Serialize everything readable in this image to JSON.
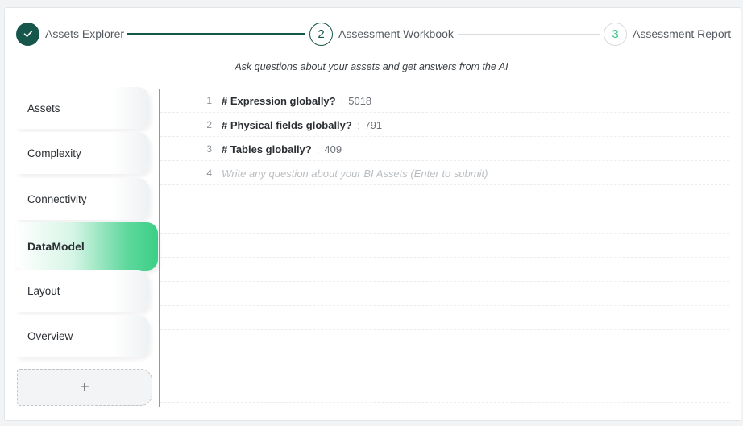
{
  "stepper": {
    "steps": [
      {
        "number": "✓",
        "label": "Assets Explorer",
        "state": "completed"
      },
      {
        "number": "2",
        "label": "Assessment Workbook",
        "state": "active"
      },
      {
        "number": "3",
        "label": "Assessment Report",
        "state": "pending"
      }
    ]
  },
  "subtitle": "Ask questions about your assets and get answers from the AI",
  "sidebar": {
    "items": [
      {
        "label": "Assets"
      },
      {
        "label": "Complexity"
      },
      {
        "label": "Connectivity"
      },
      {
        "label": "DataModel",
        "active": true
      },
      {
        "label": "Layout"
      },
      {
        "label": "Overview"
      }
    ],
    "add_label": "+"
  },
  "editor": {
    "lines": [
      {
        "number": "1",
        "question": "# Expression globally?",
        "separator": ":",
        "answer": "5018"
      },
      {
        "number": "2",
        "question": "# Physical fields globally?",
        "separator": ":",
        "answer": "791"
      },
      {
        "number": "3",
        "question": "# Tables globally?",
        "separator": ":",
        "answer": "409"
      }
    ],
    "input": {
      "number": "4",
      "placeholder": "Write any question about your BI Assets (Enter to submit)"
    }
  },
  "colors": {
    "primary": "#17564a",
    "accent": "#3cc787"
  }
}
